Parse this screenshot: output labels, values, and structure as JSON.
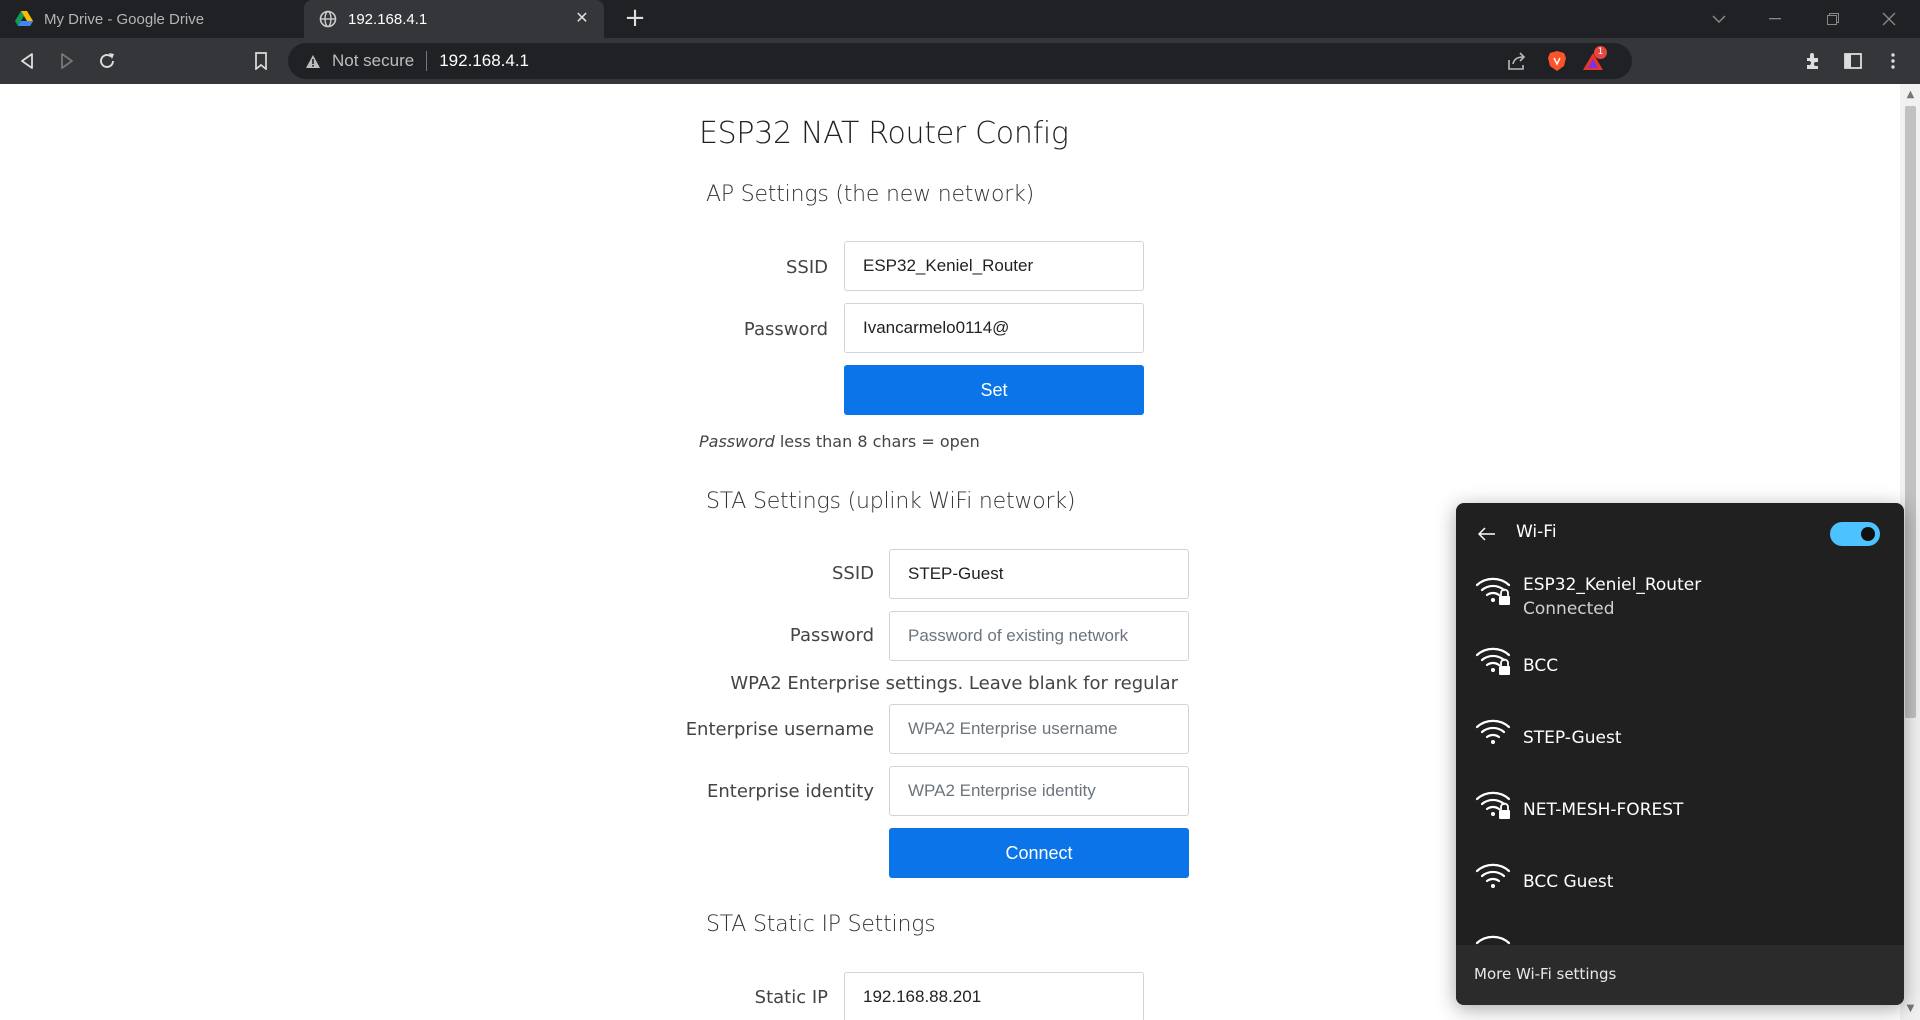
{
  "tabs": [
    {
      "title": "My Drive - Google Drive",
      "icon": "google-drive-icon",
      "active": false
    },
    {
      "title": "192.168.4.1",
      "icon": "globe-icon",
      "active": true
    }
  ],
  "toolbar": {
    "security_text": "Not secure",
    "url": "192.168.4.1",
    "notification_count": "1"
  },
  "page": {
    "title": "ESP32 NAT Router Config",
    "ap": {
      "heading": "AP Settings (the new network)",
      "ssid_label": "SSID",
      "ssid_value": "ESP32_Keniel_Router",
      "password_label": "Password",
      "password_value": "Ivancarmelo0114@",
      "set_button": "Set",
      "note_em": "Password",
      "note_rest": " less than 8 chars = open"
    },
    "sta": {
      "heading": "STA Settings (uplink WiFi network)",
      "ssid_label": "SSID",
      "ssid_value": "STEP-Guest",
      "password_label": "Password",
      "password_placeholder": "Password of existing network",
      "enterprise_note": "WPA2 Enterprise settings. Leave blank for regular",
      "ent_user_label": "Enterprise username",
      "ent_user_placeholder": "WPA2 Enterprise username",
      "ent_identity_label": "Enterprise identity",
      "ent_identity_placeholder": "WPA2 Enterprise identity",
      "connect_button": "Connect"
    },
    "static_ip": {
      "heading": "STA Static IP Settings",
      "label": "Static IP",
      "value": "192.168.88.201"
    }
  },
  "wifi_panel": {
    "title": "Wi-Fi",
    "enabled": true,
    "networks": [
      {
        "name": "ESP32_Keniel_Router",
        "status": "Connected",
        "secured": true
      },
      {
        "name": "BCC",
        "status": "",
        "secured": true
      },
      {
        "name": "STEP-Guest",
        "status": "",
        "secured": false
      },
      {
        "name": "NET-MESH-FOREST",
        "status": "",
        "secured": true
      },
      {
        "name": "BCC Guest",
        "status": "",
        "secured": false
      }
    ],
    "more_settings": "More Wi-Fi settings"
  }
}
